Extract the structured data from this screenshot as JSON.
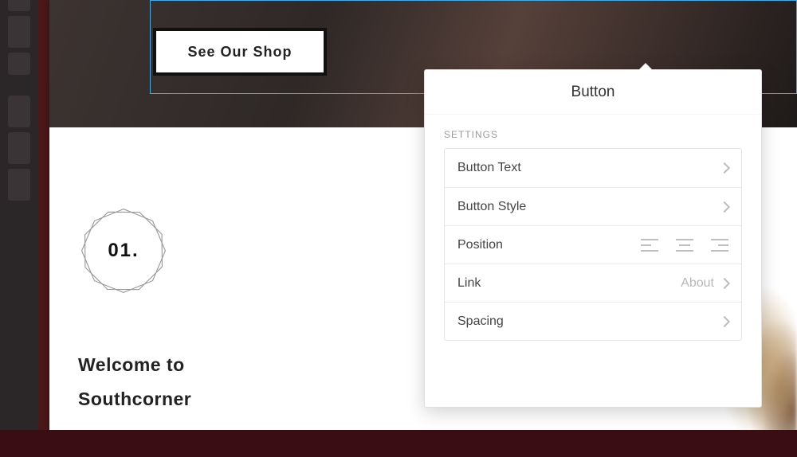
{
  "hero": {
    "button_label": "See Our Shop"
  },
  "page": {
    "badge_number": "01.",
    "welcome_line1": "Welcome to",
    "welcome_line2": "Southcorner"
  },
  "popover": {
    "title": "Button",
    "section_label": "SETTINGS",
    "rows": {
      "text": "Button Text",
      "style": "Button Style",
      "position": "Position",
      "link_label": "Link",
      "link_value": "About",
      "spacing": "Spacing"
    }
  }
}
